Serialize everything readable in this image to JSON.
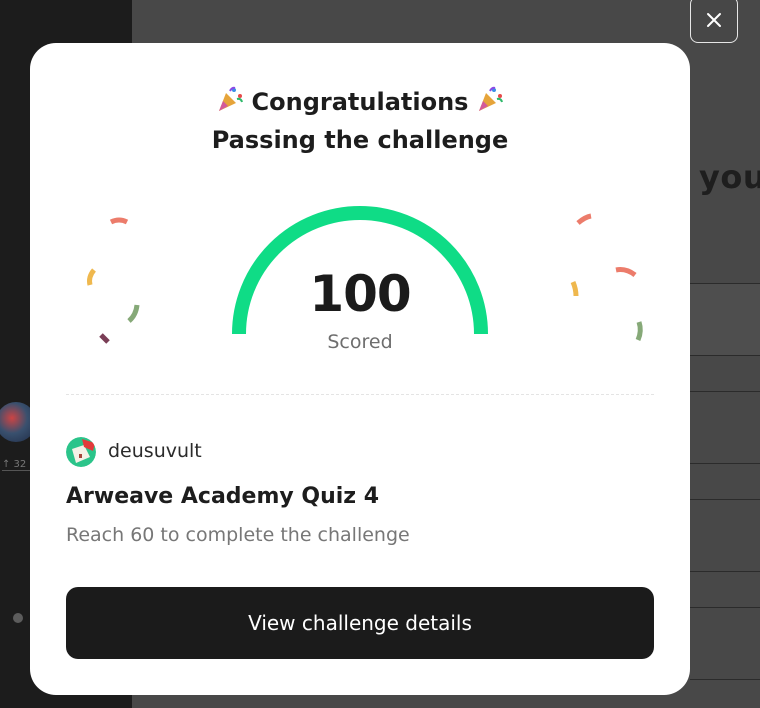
{
  "background": {
    "partial_heading": "you",
    "side_stat": "↑ 32"
  },
  "modal": {
    "title": "Congratulations",
    "subtitle": "Passing the challenge",
    "party_icon": "party-popper-icon",
    "score": {
      "value": "100",
      "label": "Scored",
      "progress_fraction": 1.0,
      "gauge_color": "#0fdc86"
    },
    "author": {
      "name": "deusuvult"
    },
    "quiz": {
      "title": "Arweave Academy Quiz 4",
      "requirement": "Reach 60 to complete the challenge"
    },
    "cta_label": "View challenge details",
    "close_icon": "close-icon"
  },
  "colors": {
    "confetti": [
      "#ec7c6b",
      "#efb84e",
      "#86a978",
      "#7a3e56"
    ]
  }
}
